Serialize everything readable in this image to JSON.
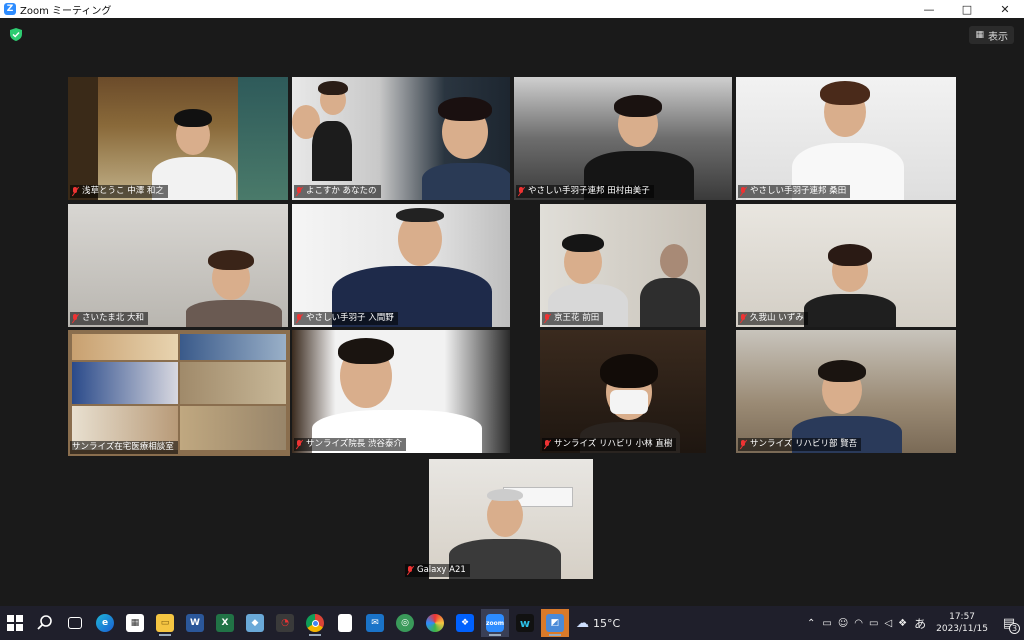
{
  "window": {
    "title": "Zoom ミーティング",
    "min_icon": "minimize-icon",
    "max_icon": "maximize-icon",
    "close_icon": "close-icon"
  },
  "header": {
    "view_label": "表示",
    "shield_color": "#2ecc71"
  },
  "participants": [
    {
      "name": "浅草とうこ 中澤 和之",
      "muted": true
    },
    {
      "name": "よこすか あなたの",
      "muted": true
    },
    {
      "name": "やさしい手羽子連邦 田村由美子",
      "muted": true
    },
    {
      "name": "やさしい手羽子連邦 桑田",
      "muted": true
    },
    {
      "name": "さいたま北 大和",
      "muted": true
    },
    {
      "name": "やさしい手羽子 入間野",
      "muted": true
    },
    {
      "name": "京王花 前田",
      "muted": true
    },
    {
      "name": "久我山 いずみ",
      "muted": false
    },
    {
      "name": "サンライズ在宅医療相談室",
      "muted": false,
      "active": true
    },
    {
      "name": "サンライズ院長 渋谷泰介",
      "muted": true
    },
    {
      "name": "サンライズ リハビリ 小林 直樹",
      "muted": true
    },
    {
      "name": "サンライズ リハビリ部 賢吾",
      "muted": true
    },
    {
      "name": "Galaxy A21",
      "muted": true
    }
  ],
  "taskbar": {
    "weather_temp": "15°C",
    "time": "17:57",
    "date": "2023/11/15",
    "ime": "あ",
    "notification_count": "3",
    "icons": [
      "windows-start-icon",
      "search-icon",
      "task-view-icon",
      "edge-icon",
      "store-icon",
      "file-explorer-icon",
      "word-icon",
      "excel-icon",
      "notes-icon",
      "app-icon",
      "chrome-icon",
      "file-icon",
      "mail-icon",
      "globe-icon",
      "photo-icon",
      "dropbox-icon",
      "zoom-icon",
      "webex-icon",
      "docs-icon"
    ]
  },
  "colors": {
    "active_border": "#b8e62e",
    "muted_red": "#e33333",
    "zoom_blue": "#2d8cff"
  }
}
